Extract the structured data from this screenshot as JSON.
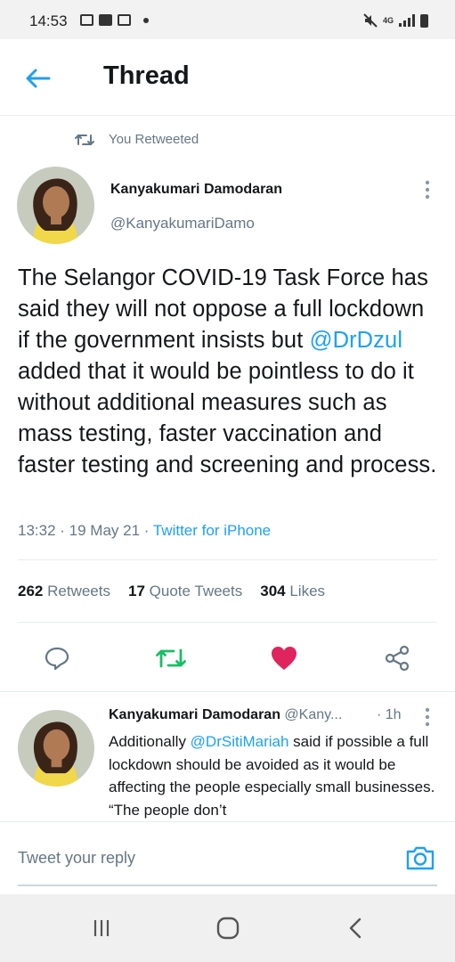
{
  "status_bar": {
    "time": "14:53",
    "network": "4G"
  },
  "header": {
    "title": "Thread",
    "back_icon": "arrow-left-icon"
  },
  "retweet_context": {
    "label": "You Retweeted",
    "icon": "retweet-icon"
  },
  "main_tweet": {
    "author_name": "Kanyakumari Damodaran",
    "author_handle": "@KanyakumariDamo",
    "text_part1": "The Selangor COVID-19 Task Force has said they will not oppose a full lockdown if the government insists but ",
    "mention": "@DrDzul",
    "text_part2": " added that it would be pointless to do it without additional measures such as mass testing, faster vaccination and faster testing and screening and process.",
    "time": "13:32",
    "date": "19 May 21",
    "source": "Twitter for iPhone",
    "separator": " · "
  },
  "stats": {
    "retweets_count": "262",
    "retweets_label": "Retweets",
    "quotes_count": "17",
    "quotes_label": "Quote Tweets",
    "likes_count": "304",
    "likes_label": "Likes"
  },
  "actions": {
    "reply_icon": "speech-bubble-icon",
    "retweet_icon": "retweet-icon",
    "like_icon": "heart-icon",
    "share_icon": "share-icon",
    "retweet_color": "#17bf63",
    "like_color": "#e0245e"
  },
  "reply_tweet": {
    "author_name": "Kanyakumari Damodaran",
    "author_handle": "@Kany...",
    "time": "· 1h",
    "text_part1": "Additionally ",
    "mention": "@DrSitiMariah",
    "text_part2": " said if possible a full lockdown should be avoided as it would be affecting the people especially small businesses. “The people don’t"
  },
  "compose": {
    "placeholder": "Tweet your reply",
    "camera_icon": "camera-icon"
  },
  "colors": {
    "accent": "#1da1f2",
    "text_secondary": "#657786"
  }
}
